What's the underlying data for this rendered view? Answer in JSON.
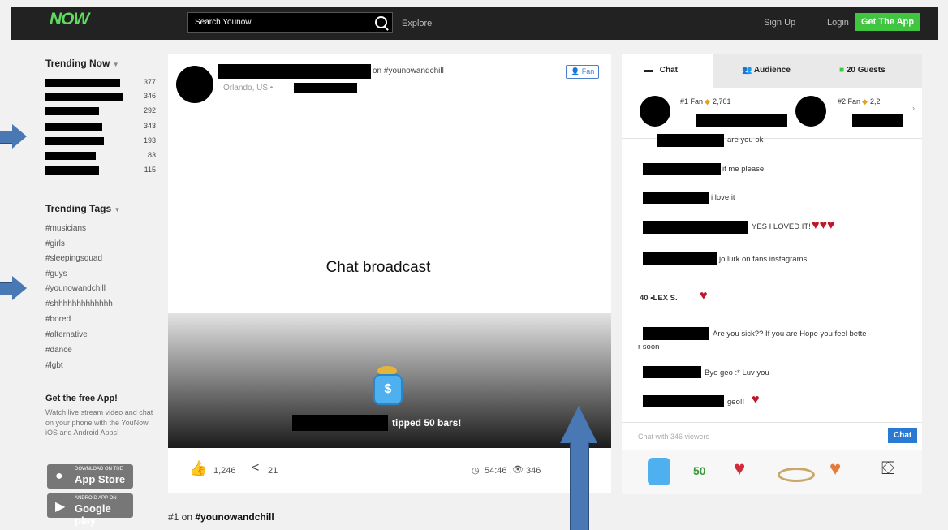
{
  "topbar": {
    "logo": "NOW",
    "search_placeholder": "Search Younow",
    "explore": "Explore",
    "signup": "Sign Up",
    "login": "Login",
    "get_app": "Get The App"
  },
  "sidebar": {
    "trending_now_title": "Trending Now",
    "trending_counts": [
      "377",
      "346",
      "292",
      "343",
      "193",
      "83",
      "115"
    ],
    "trending_tags_title": "Trending Tags",
    "tags": [
      "#musicians",
      "#girls",
      "#sleepingsquad",
      "#guys",
      "#younowandchill",
      "#shhhhhhhhhhhhh",
      "#bored",
      "#alternative",
      "#dance",
      "#lgbt"
    ],
    "promo_title": "Get the free App!",
    "promo_text": "Watch live stream video and chat on your phone with the YouNow iOS and Android Apps!",
    "appstore_small": "Download on the",
    "appstore_large": "App Store",
    "googleplay_small": "Android app on",
    "googleplay_large": "Google play"
  },
  "broadcast": {
    "on_tag": "on #younowandchill",
    "location": "Orlando, US •",
    "fan_button": "Fan",
    "overlay_label": "Chat broadcast",
    "tipped": "tipped 50 bars!",
    "likes": "1,246",
    "shares": "21",
    "duration": "54:46",
    "viewers": "346",
    "bottom_rank": "#1 on",
    "bottom_tag": "#younowandchill"
  },
  "chat": {
    "tab_chat": "Chat",
    "tab_audience": "Audience",
    "tab_guests": "20 Guests",
    "fan1_rank": "#1 Fan",
    "fan1_value": "2,701",
    "fan2_rank": "#2 Fan",
    "fan2_value": "2,2",
    "messages": [
      "are you ok",
      "it me please",
      "i love it",
      "YES I LOVED IT!",
      "jo lurk on fans instagrams",
      "40 •LEX S.",
      "Are you sick?? If you are Hope you feel bette",
      "r soon",
      "Bye geo :* Luv you",
      "geo!!"
    ],
    "input_placeholder": "Chat with 346 viewers",
    "send_button": "Chat",
    "gift_50": "50"
  }
}
